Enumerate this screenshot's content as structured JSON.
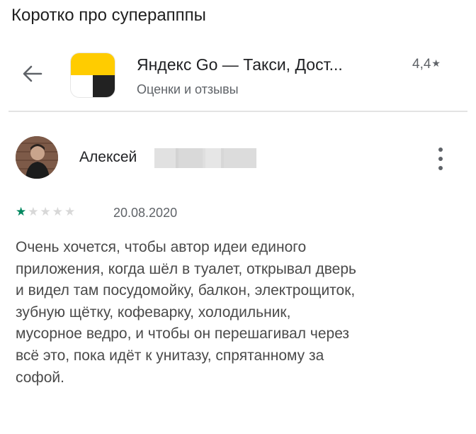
{
  "caption": "Коротко про суперапппы",
  "header": {
    "back_icon": "arrow-left-icon",
    "app_icon": "yandex-go-app-icon",
    "app_title": "Яндекс Go — Такси, Дост...",
    "rating": "4,4",
    "rating_star": "★",
    "subtitle": "Оценки и отзывы"
  },
  "review": {
    "author": "Алексей",
    "date": "20.08.2020",
    "stars_filled": 1,
    "stars_total": 5,
    "text_lines": [
      "Очень хочется, чтобы автор идеи единого",
      "приложения, когда шёл в туалет, открывал дверь",
      "и видел там посудомойку, балкон, электрощиток,",
      "зубную щётку, кофеварку, холодильник,",
      "мусорное ведро, и чтобы он перешагивал через",
      "всё это, пока идёт к унитазу, спрятанному за",
      "софой."
    ]
  },
  "colors": {
    "accent_green": "#01875f",
    "yandex_yellow": "#ffcc00"
  }
}
